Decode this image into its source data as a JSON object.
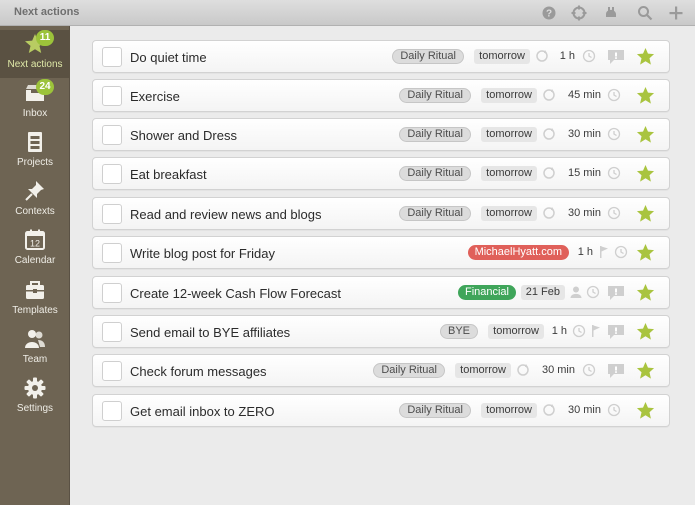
{
  "titlebar": {
    "title": "Next actions",
    "icons": [
      "help-icon",
      "sync-icon",
      "undo-icon",
      "search-icon",
      "add-icon"
    ]
  },
  "sidebar": {
    "items": [
      {
        "label": "Next actions",
        "icon": "star-icon",
        "badge": "11",
        "active": true
      },
      {
        "label": "Inbox",
        "icon": "inbox-icon",
        "badge": "24"
      },
      {
        "label": "Projects",
        "icon": "projects-icon"
      },
      {
        "label": "Contexts",
        "icon": "pin-icon"
      },
      {
        "label": "Calendar",
        "icon": "calendar-icon",
        "day": "12"
      },
      {
        "label": "Templates",
        "icon": "toolbox-icon"
      },
      {
        "label": "Team",
        "icon": "team-icon"
      },
      {
        "label": "Settings",
        "icon": "gear-icon"
      }
    ]
  },
  "tasks": [
    {
      "title": "Do quiet time",
      "tag": "Daily Ritual",
      "date": "tomorrow",
      "duration": "1 h"
    },
    {
      "title": "Exercise",
      "tag": "Daily Ritual",
      "date": "tomorrow",
      "duration": "45 min"
    },
    {
      "title": "Shower and Dress",
      "tag": "Daily Ritual",
      "date": "tomorrow",
      "duration": "30 min"
    },
    {
      "title": "Eat breakfast",
      "tag": "Daily Ritual",
      "date": "tomorrow",
      "duration": "15 min"
    },
    {
      "title": "Read and review news and blogs",
      "tag": "Daily Ritual",
      "date": "tomorrow",
      "duration": "30 min"
    },
    {
      "title": "Write blog post for Friday",
      "tag": "MichaelHyatt.com",
      "duration": "1 h"
    },
    {
      "title": "Create 12-week Cash Flow Forecast",
      "tag": "Financial",
      "date": "21 Feb"
    },
    {
      "title": "Send email to BYE affiliates",
      "tag": "BYE",
      "date": "tomorrow",
      "duration": "1 h"
    },
    {
      "title": "Check forum messages",
      "tag": "Daily Ritual",
      "date": "tomorrow",
      "duration": "30 min"
    },
    {
      "title": "Get email inbox to ZERO",
      "tag": "Daily Ritual",
      "date": "tomorrow",
      "duration": "30 min"
    }
  ],
  "colors": {
    "sidebar": "#6e6453",
    "accent_star": "#a9c43f",
    "badge": "#9cc33a",
    "tag_red": "#e0605a",
    "tag_green": "#3fa55a"
  }
}
